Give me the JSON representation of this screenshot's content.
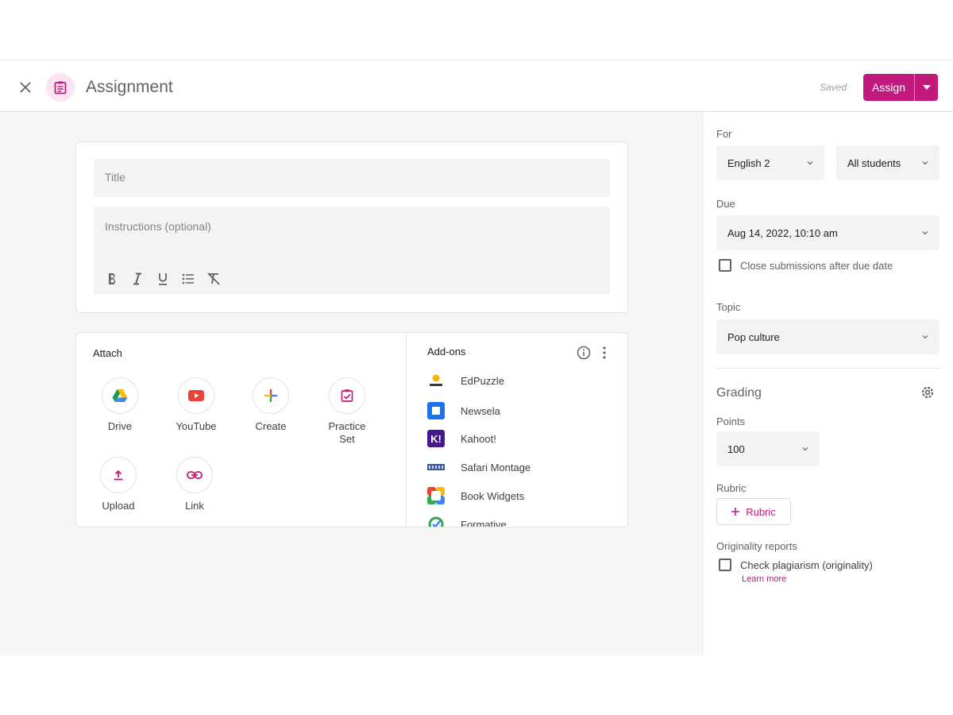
{
  "header": {
    "title": "Assignment",
    "saved_text": "Saved",
    "assign_label": "Assign",
    "accent_color": "#c2197c"
  },
  "editor": {
    "title_placeholder": "Title",
    "instructions_placeholder": "Instructions (optional)",
    "format_buttons": [
      "bold-icon",
      "italic-icon",
      "underline-icon",
      "bulleted-list-icon",
      "clear-format-icon"
    ]
  },
  "attach": {
    "label": "Attach",
    "items": [
      {
        "label": "Drive",
        "icon": "drive-icon"
      },
      {
        "label": "YouTube",
        "icon": "youtube-icon"
      },
      {
        "label": "Create",
        "icon": "create-plus-icon"
      },
      {
        "label": "Practice Set",
        "icon": "practice-set-icon"
      },
      {
        "label": "Upload",
        "icon": "upload-icon"
      },
      {
        "label": "Link",
        "icon": "link-icon"
      }
    ]
  },
  "addons": {
    "label": "Add-ons",
    "items": [
      {
        "name": "EdPuzzle",
        "icon": "edpuzzle-icon"
      },
      {
        "name": "Newsela",
        "icon": "newsela-icon"
      },
      {
        "name": "Kahoot!",
        "icon": "kahoot-icon"
      },
      {
        "name": "Safari Montage",
        "icon": "safari-montage-icon"
      },
      {
        "name": "Book Widgets",
        "icon": "book-widgets-icon"
      },
      {
        "name": "Formative",
        "icon": "formative-icon"
      }
    ]
  },
  "sidebar": {
    "for_label": "For",
    "class_value": "English 2",
    "students_value": "All students",
    "due_label": "Due",
    "due_value": "Aug 14, 2022, 10:10 am",
    "close_submissions_label": "Close submissions after due date",
    "topic_label": "Topic",
    "topic_value": "Pop culture",
    "grading_label": "Grading",
    "points_label": "Points",
    "points_value": "100",
    "rubric_label": "Rubric",
    "rubric_button": "Rubric",
    "originality_label": "Originality reports",
    "plagiarism_label": "Check plagiarism (originality)",
    "learn_more": "Learn more"
  }
}
